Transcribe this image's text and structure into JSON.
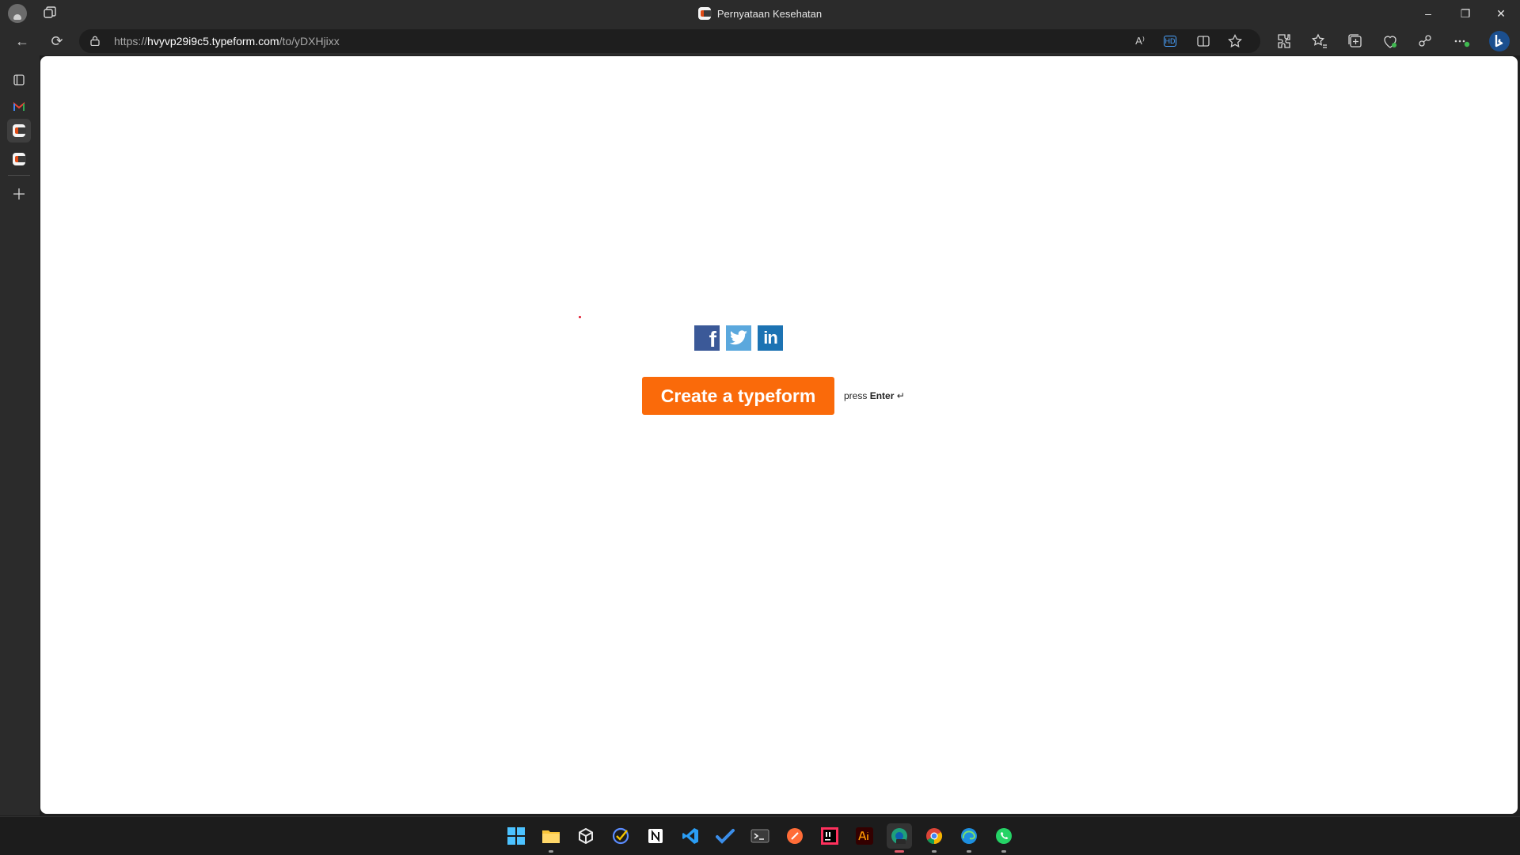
{
  "browser": {
    "tab_title": "Pernyataan Kesehatan",
    "url_prefix": "https://",
    "url_host": "hvyvp29i9c5.typeform.com",
    "url_path": "/to/yDXHjixx",
    "window_controls": {
      "minimize": "–",
      "restore": "❐",
      "close": "✕"
    }
  },
  "toolbar": {
    "back": "←",
    "refresh": "⟳",
    "read_aloud": "A⁾",
    "hd_badge": "HD"
  },
  "page": {
    "cta_label": "Create a typeform",
    "hint_press": "press",
    "hint_key": "Enter",
    "hint_symbol": "↵",
    "social": {
      "facebook": "f",
      "linkedin": "in"
    },
    "colors": {
      "cta": "#fa6a0a",
      "facebook": "#3b5998",
      "twitter": "#5ba8dd",
      "linkedin": "#1c73b3"
    }
  }
}
